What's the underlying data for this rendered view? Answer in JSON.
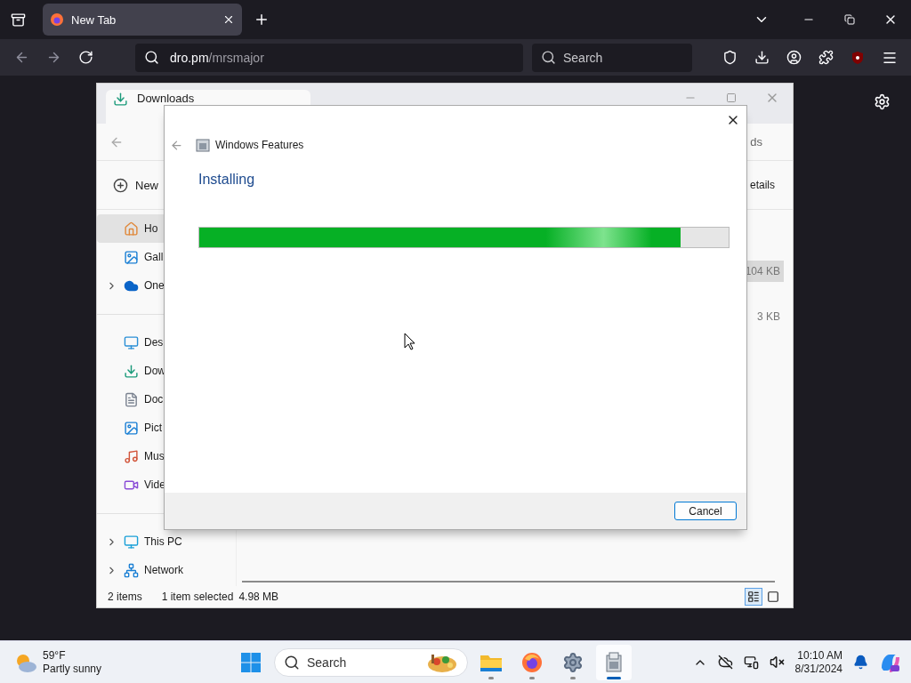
{
  "browser": {
    "tabs": [
      {
        "title": "New Tab",
        "selected": true
      }
    ],
    "address": {
      "host": "dro.pm",
      "path": "/mrsmajor"
    },
    "search_placeholder": "Search"
  },
  "explorer": {
    "tab_title": "Downloads",
    "new_label": "New",
    "header_fragment": "ds",
    "details_fragment": "etails",
    "sidebar": [
      [
        {
          "label": "Ho",
          "kind": "home",
          "expandable": false,
          "selected": true
        },
        {
          "label": "Gall",
          "kind": "gallery",
          "expandable": false,
          "selected": false
        },
        {
          "label": "One",
          "kind": "cloud",
          "expandable": true,
          "selected": false
        }
      ],
      [
        {
          "label": "Des",
          "kind": "desktop",
          "expandable": false,
          "selected": false
        },
        {
          "label": "Dow",
          "kind": "downloads",
          "expandable": false,
          "selected": false
        },
        {
          "label": "Doc",
          "kind": "documents",
          "expandable": false,
          "selected": false
        },
        {
          "label": "Pict",
          "kind": "pictures",
          "expandable": false,
          "selected": false
        },
        {
          "label": "Mus",
          "kind": "music",
          "expandable": false,
          "selected": false
        },
        {
          "label": "Vide",
          "kind": "videos",
          "expandable": false,
          "selected": false
        }
      ],
      [
        {
          "label": "This PC",
          "kind": "pc",
          "expandable": true,
          "selected": false
        },
        {
          "label": "Network",
          "kind": "network",
          "expandable": true,
          "selected": false
        }
      ]
    ],
    "sizes": [
      {
        "text": "104 KB",
        "selected": true
      },
      {
        "text": "3 KB",
        "selected": false
      }
    ],
    "status": {
      "items": "2 items",
      "selection": "1 item selected",
      "size": "4.98 MB"
    },
    "views": [
      {
        "kind": "details",
        "selected": true
      },
      {
        "kind": "tiles",
        "selected": false
      }
    ]
  },
  "dialog": {
    "title": "Windows Features",
    "heading": "Installing",
    "progress": {
      "level": 0.91
    },
    "buttons": [
      "Cancel"
    ]
  },
  "taskbar": {
    "weather": {
      "temperature": "59°F",
      "condition": "Partly sunny"
    },
    "search_placeholder": "Search",
    "apps": [
      {
        "kind": "explorer",
        "active": false
      },
      {
        "kind": "firefox",
        "active": false
      },
      {
        "kind": "settings",
        "active": false
      },
      {
        "kind": "features",
        "active": true
      }
    ],
    "time": "10:10 AM",
    "date": "8/31/2024"
  }
}
